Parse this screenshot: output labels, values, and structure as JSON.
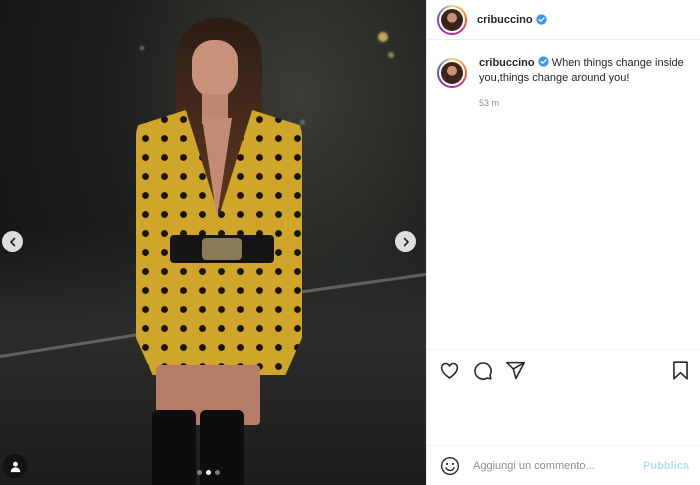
{
  "post": {
    "username": "cribuccino",
    "verified": true,
    "caption": "When things change inside you,things change around you!",
    "timestamp": "53 m"
  },
  "carousel": {
    "slide_count": 3,
    "active_slide": 2,
    "prev_icon": "chevron-left-icon",
    "next_icon": "chevron-right-icon"
  },
  "actions": {
    "like_icon": "heart-icon",
    "comment_icon": "comment-bubble-icon",
    "share_icon": "paper-plane-icon",
    "save_icon": "bookmark-icon"
  },
  "add_comment": {
    "placeholder": "Aggiungi un commento...",
    "publish_label": "Pubblica"
  },
  "colors": {
    "verified_blue": "#3897f0",
    "publish_disabled": "#b2dffc",
    "dress_mustard": "#cfa62a"
  }
}
